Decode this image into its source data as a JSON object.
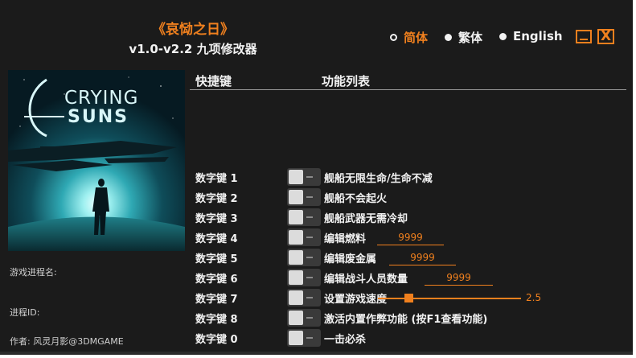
{
  "app": {
    "title": "《哀恸之日》",
    "version": "v1.0-v2.2 九项修改器"
  },
  "languages": [
    {
      "label": "简体",
      "selected": true
    },
    {
      "label": "繁体",
      "selected": false
    },
    {
      "label": "English",
      "selected": false
    }
  ],
  "window_buttons": {
    "minimize": "minimize-icon",
    "close": "close-icon",
    "close_glyph": "X"
  },
  "cover": {
    "logo_line1": "CRYING",
    "logo_line2": "SUNS"
  },
  "sidebar": {
    "process_name_label": "游戏进程名:",
    "process_id_label": "进程ID:",
    "author": "作者: 风灵月影@3DMGAME"
  },
  "table": {
    "header_key": "快捷键",
    "header_function": "功能列表"
  },
  "cheats": [
    {
      "key": "数字键 1",
      "label": "舰船无限生命/生命不减",
      "enabled": false
    },
    {
      "key": "数字键 2",
      "label": "舰船不会起火",
      "enabled": false
    },
    {
      "key": "数字键 3",
      "label": "舰船武器无需冷却",
      "enabled": false
    },
    {
      "key": "数字键 4",
      "label": "编辑燃料",
      "enabled": false,
      "value": "9999"
    },
    {
      "key": "数字键 5",
      "label": "编辑废金属",
      "enabled": false,
      "value": "9999"
    },
    {
      "key": "数字键 6",
      "label": "编辑战斗人员数量",
      "enabled": false,
      "value": "9999"
    },
    {
      "key": "数字键 7",
      "label": "设置游戏速度",
      "enabled": false,
      "value": "2.5"
    },
    {
      "key": "数字键 8",
      "label": "激活内置作弊功能 (按F1查看功能)",
      "enabled": false
    },
    {
      "key": "数字键 0",
      "label": "一击必杀",
      "enabled": false
    }
  ],
  "colors": {
    "accent": "#f0801e",
    "background": "#1b1b1b",
    "text": "#f2f2f2"
  }
}
